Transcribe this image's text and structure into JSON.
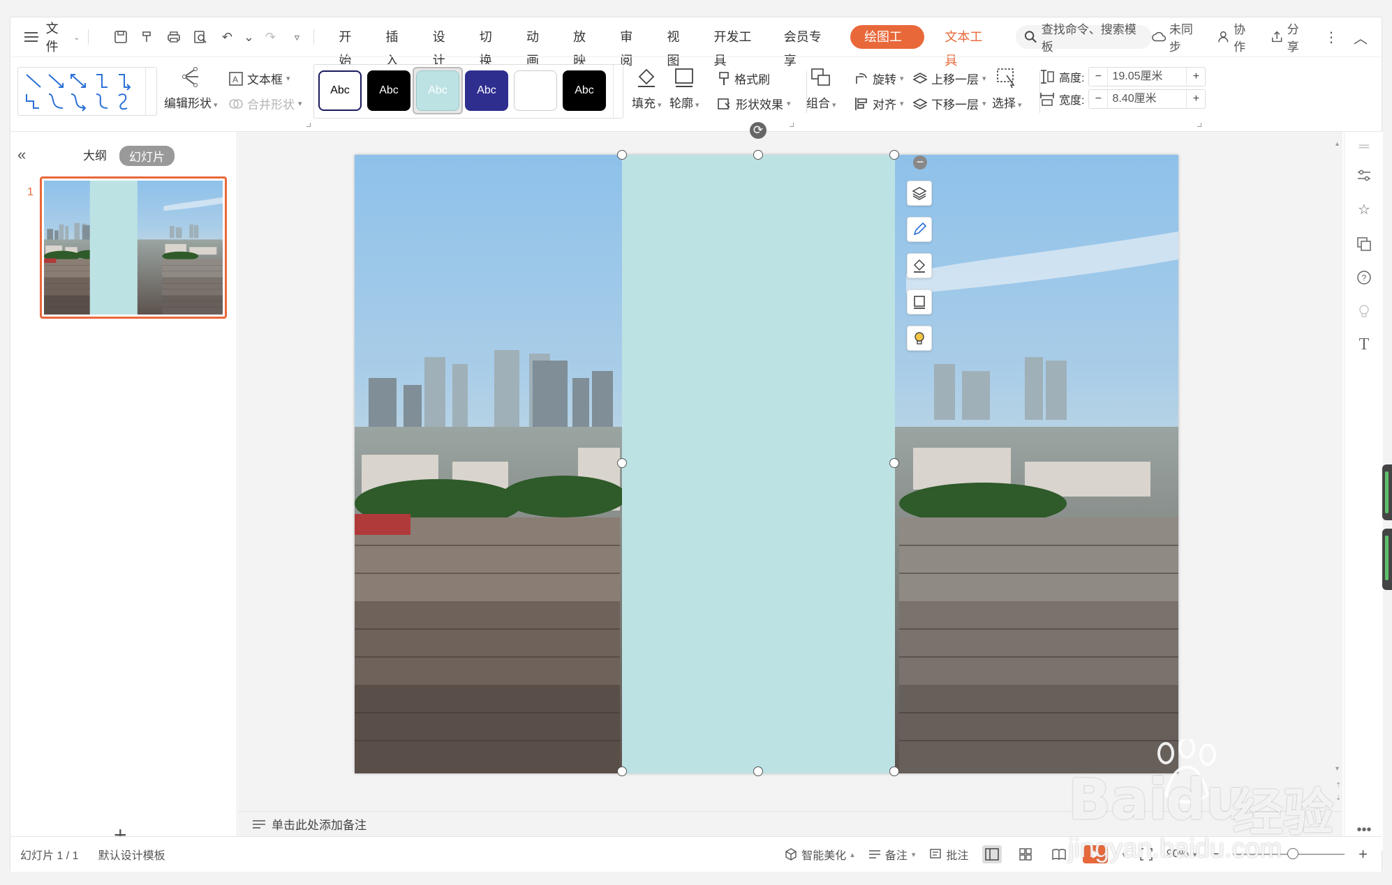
{
  "menubar": {
    "file_label": "文件",
    "tabs": [
      "开始",
      "插入",
      "设计",
      "切换",
      "动画",
      "放映",
      "审阅",
      "视图",
      "开发工具",
      "会员专享"
    ],
    "active_tab": "绘图工具",
    "text_tool_tab": "文本工具",
    "search_placeholder": "查找命令、搜索模板",
    "sync_label": "未同步",
    "collab_label": "协作",
    "share_label": "分享"
  },
  "ribbon": {
    "edit_shape": "编辑形状",
    "text_box": "文本框",
    "merge_shape": "合并形状",
    "style_label": "Abc",
    "fill": "填充",
    "outline": "轮廓",
    "format_painter": "格式刷",
    "shape_effect": "形状效果",
    "group": "组合",
    "rotate": "旋转",
    "align": "对齐",
    "bring_forward": "上移一层",
    "send_backward": "下移一层",
    "select": "选择",
    "height_label": "高度:",
    "height_value": "19.05厘米",
    "width_label": "宽度:",
    "width_value": "8.40厘米"
  },
  "left_panel": {
    "outline_tab": "大纲",
    "slides_tab": "幻灯片",
    "slide_number": "1"
  },
  "notes": {
    "placeholder": "单击此处添加备注"
  },
  "statusbar": {
    "slide_info": "幻灯片 1 / 1",
    "template": "默认设计模板",
    "smart_beautify": "智能美化",
    "notes": "备注",
    "comments": "批注",
    "zoom": "90%"
  },
  "watermark": {
    "brand": "Bai",
    "brand2": "du",
    "cn": "经验",
    "url": "jingyan.baidu.com"
  },
  "colors": {
    "accent": "#e8683a",
    "shape_fill": "#bde2e4",
    "swatches": [
      "#ffffff",
      "#000000",
      "#bde2e4",
      "#2e2e8f",
      "#ffffff",
      "#000000"
    ]
  }
}
